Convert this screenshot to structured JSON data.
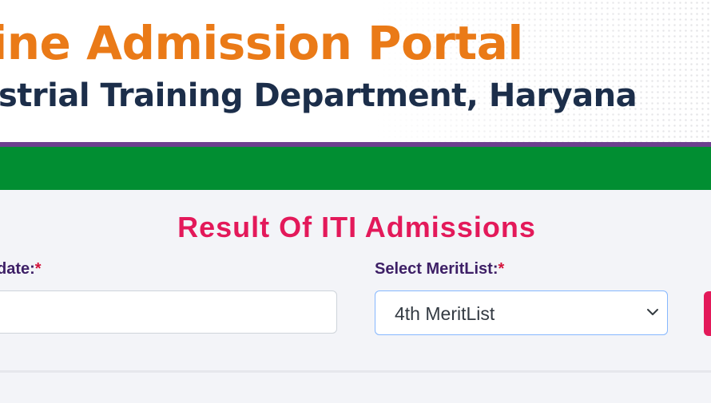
{
  "header": {
    "portal_title": "line Admission Portal",
    "department": "ustrial Training Department, Haryana"
  },
  "result": {
    "title": "Result Of ITI Admissions"
  },
  "form": {
    "date_label": "date:",
    "merit_label": "Select MeritList:",
    "required_mark": "*",
    "date_value": "",
    "merit_selected": "4th MeritList"
  },
  "colors": {
    "portal_title": "#ea7a17",
    "department": "#1c2e4a",
    "purple_bar": "#6d3f8f",
    "nav_green": "#018e32",
    "result_title": "#e3195a",
    "label": "#3d1f66",
    "required": "#d4143c",
    "button": "#e3195a"
  }
}
